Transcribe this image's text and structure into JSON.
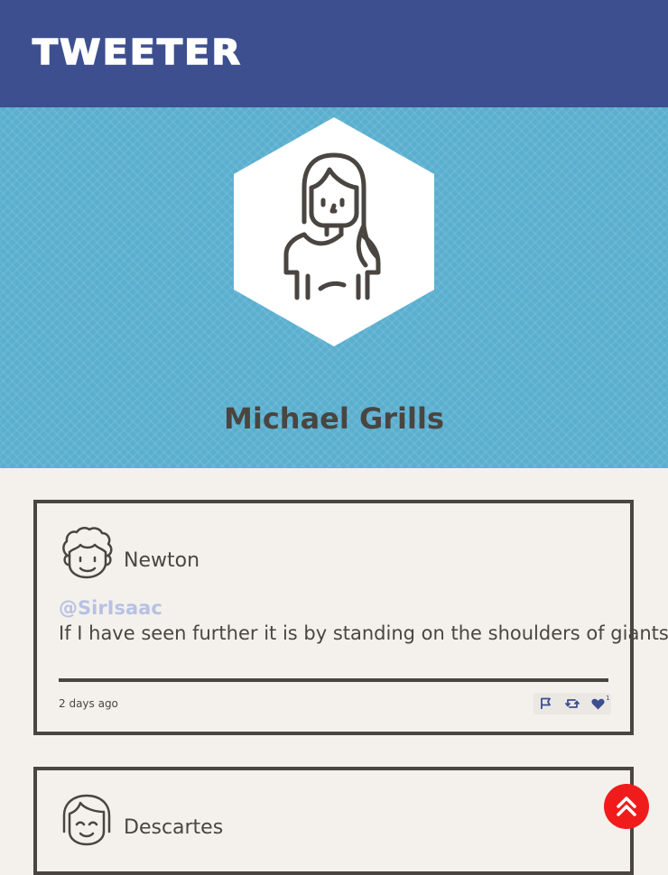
{
  "header": {
    "logo_text": "TWEETER"
  },
  "profile": {
    "name": "Michael Grills",
    "avatar_icon": "person-long-hair-icon"
  },
  "tweets": [
    {
      "author_name": "Newton",
      "author_handle": "@SirIsaac",
      "avatar_icon": "curly-hair-face-icon",
      "text": "If I have seen further it is by standing on the shoulders of giants",
      "time": "2 days ago",
      "like_count": "1"
    },
    {
      "author_name": "Descartes",
      "avatar_icon": "bob-hair-face-icon"
    }
  ],
  "colors": {
    "navbar": "#3d4f8f",
    "banner": "#5aafcf",
    "handle": "#b8c1e4",
    "text": "#4a4540",
    "scroll_button": "#f01c1c"
  },
  "scroll_button_icon": "double-chevron-up-icon"
}
